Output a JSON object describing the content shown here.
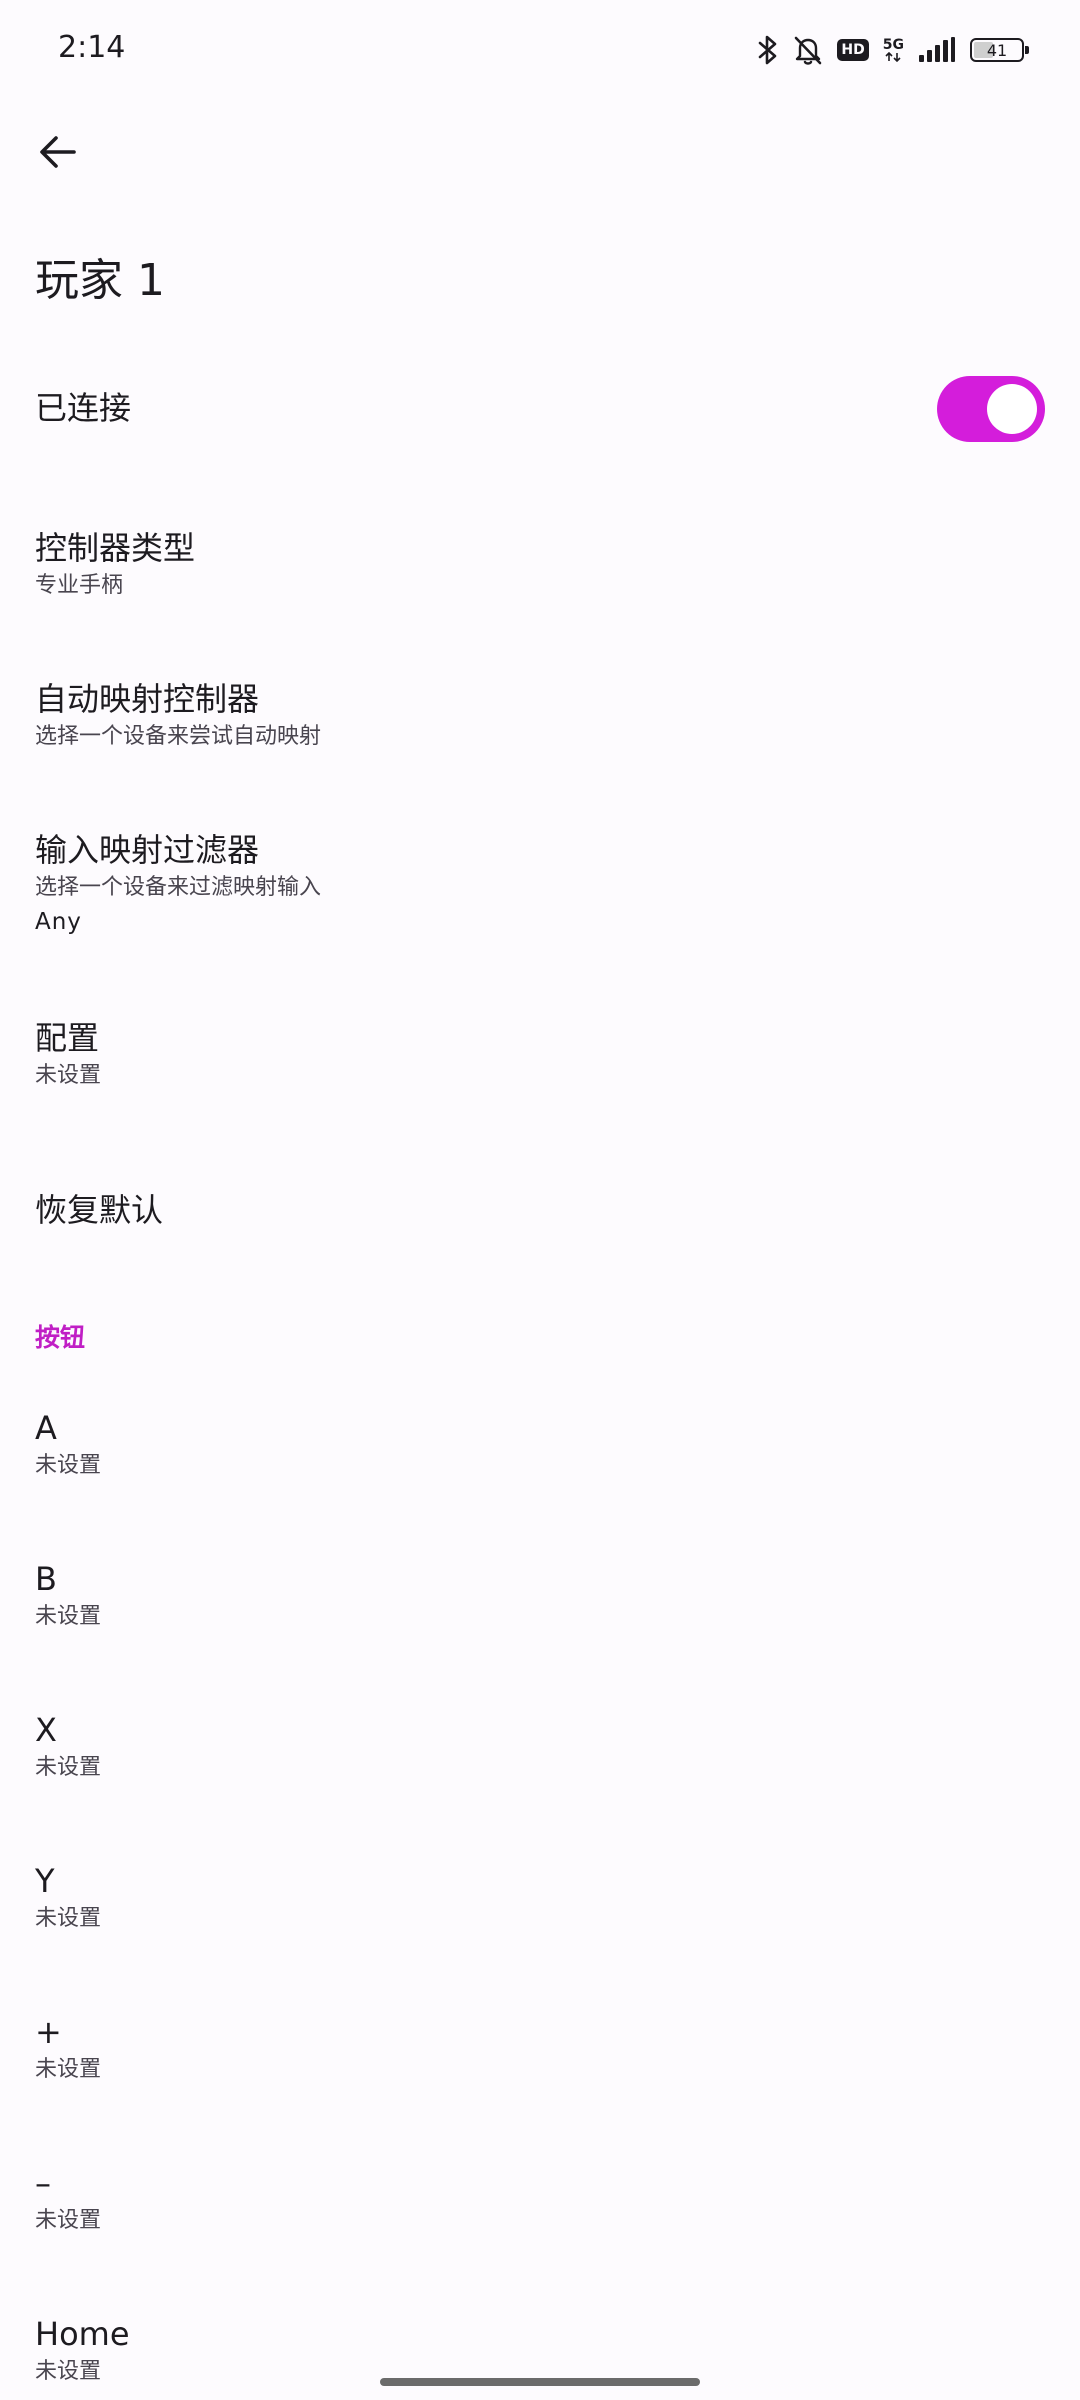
{
  "status_bar": {
    "time": "2:14",
    "network_type": "5G",
    "hd_label": "HD",
    "battery_level": "41",
    "battery_fraction": 0.41
  },
  "header": {
    "title": "玩家 1"
  },
  "connected": {
    "label": "已连接",
    "enabled": true
  },
  "settings": {
    "controller_type": {
      "title": "控制器类型",
      "value": "专业手柄"
    },
    "auto_map": {
      "title": "自动映射控制器",
      "subtitle": "选择一个设备来尝试自动映射"
    },
    "input_filter": {
      "title": "输入映射过滤器",
      "subtitle": "选择一个设备来过滤映射输入",
      "value": "Any"
    },
    "profile": {
      "title": "配置",
      "value": "未设置"
    },
    "reset": {
      "title": "恢复默认"
    }
  },
  "buttons_section": {
    "header": "按钮",
    "items": [
      {
        "label": "A",
        "value": "未设置"
      },
      {
        "label": "B",
        "value": "未设置"
      },
      {
        "label": "X",
        "value": "未设置"
      },
      {
        "label": "Y",
        "value": "未设置"
      },
      {
        "label": "+",
        "value": "未设置"
      },
      {
        "label": "–",
        "value": "未设置"
      },
      {
        "label": "Home",
        "value": "未设置"
      }
    ]
  },
  "colors": {
    "accent": "#d41ddb",
    "section_header": "#c01ec5",
    "background": "#fdfbfe"
  },
  "icons": {
    "back": "arrow-left-icon",
    "bluetooth": "bluetooth-icon",
    "mute": "bell-off-icon",
    "signal": "signal-bars-icon",
    "battery": "battery-icon"
  }
}
